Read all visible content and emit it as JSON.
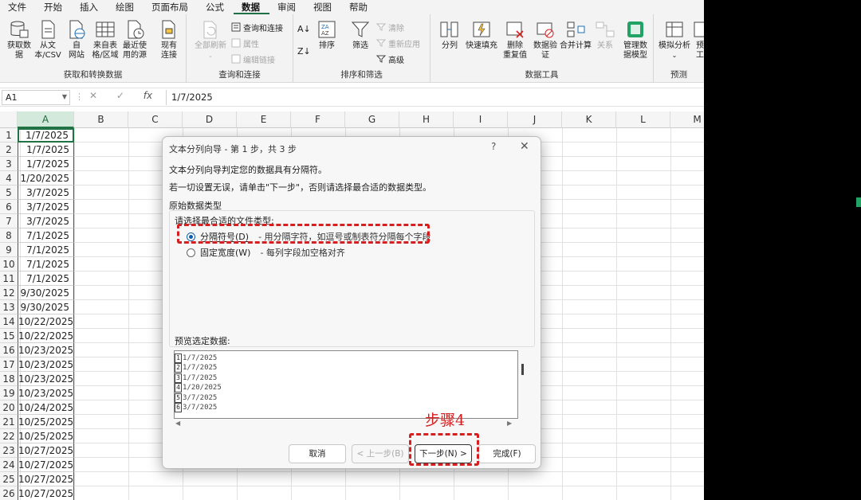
{
  "menu": [
    "文件",
    "开始",
    "插入",
    "绘图",
    "页面布局",
    "公式",
    "数据",
    "审阅",
    "视图",
    "帮助"
  ],
  "menu_active": "数据",
  "ribbon": {
    "groups": [
      {
        "label": "获取和转换数据",
        "buttons": [
          "获取数\n据",
          "从文\n本/CSV",
          "自\n网站",
          "来自表\n格/区域",
          "最近使\n用的源",
          "现有\n连接"
        ]
      },
      {
        "label": "查询和连接",
        "buttons": [
          "全部刷新"
        ],
        "small": [
          "查询和连接",
          "属性",
          "编辑链接"
        ]
      },
      {
        "label": "排序和筛选",
        "buttons": [
          "排序",
          "筛选"
        ],
        "small": [
          "清除",
          "重新应用",
          "高级"
        ]
      },
      {
        "label": "数据工具",
        "buttons": [
          "分列",
          "快速填充",
          "删除\n重复值",
          "数据验\n证",
          "合并计算",
          "关系",
          "管理数\n据模型"
        ]
      },
      {
        "label": "预测",
        "buttons": [
          "模拟分析",
          "预\n工"
        ]
      }
    ]
  },
  "formula_bar": {
    "name_box": "A1",
    "fx": "fx",
    "formula": "1/7/2025"
  },
  "columns": [
    "A",
    "B",
    "C",
    "D",
    "E",
    "F",
    "G",
    "H",
    "I",
    "J",
    "K",
    "L",
    "M"
  ],
  "rows": [
    "1",
    "2",
    "3",
    "4",
    "5",
    "6",
    "7",
    "8",
    "9",
    "10",
    "11",
    "12",
    "13",
    "14",
    "15",
    "16",
    "17",
    "18",
    "19",
    "20",
    "21",
    "22",
    "23",
    "24",
    "25",
    "26"
  ],
  "column_a": [
    "1/7/2025",
    "1/7/2025",
    "1/7/2025",
    "1/20/2025",
    "3/7/2025",
    "3/7/2025",
    "3/7/2025",
    "7/1/2025",
    "7/1/2025",
    "7/1/2025",
    "7/1/2025",
    "9/30/2025",
    "9/30/2025",
    "10/22/2025",
    "10/22/2025",
    "10/23/2025",
    "10/23/2025",
    "10/23/2025",
    "10/23/2025",
    "10/24/2025",
    "10/25/2025",
    "10/25/2025",
    "10/27/2025",
    "10/27/2025",
    "10/27/2025",
    "10/27/2025"
  ],
  "dialog": {
    "title": "文本分列向导 - 第 1 步，共 3 步",
    "help": "?",
    "close": "✕",
    "line1": "文本分列向导判定您的数据具有分隔符。",
    "line2": "若一切设置无误，请单击\"下一步\"，否则请选择最合适的数据类型。",
    "section": "原始数据类型",
    "prompt": "请选择最合适的文件类型:",
    "option1": {
      "label": "分隔符号(D)",
      "desc": "- 用分隔字符，如逗号或制表符分隔每个字段",
      "selected": true
    },
    "option2": {
      "label": "固定宽度(W)",
      "desc": "- 每列字段加空格对齐",
      "selected": false
    },
    "preview_label": "预览选定数据:",
    "preview_rows": [
      {
        "n": "1",
        "v": "1/7/2025"
      },
      {
        "n": "2",
        "v": "1/7/2025"
      },
      {
        "n": "3",
        "v": "1/7/2025"
      },
      {
        "n": "4",
        "v": "1/20/2025"
      },
      {
        "n": "5",
        "v": "3/7/2025"
      },
      {
        "n": "6",
        "v": "3/7/2025"
      }
    ],
    "buttons": {
      "cancel": "取消",
      "back": "< 上一步(B)",
      "next": "下一步(N) >",
      "finish": "完成(F)"
    }
  },
  "annotation": "步骤4"
}
